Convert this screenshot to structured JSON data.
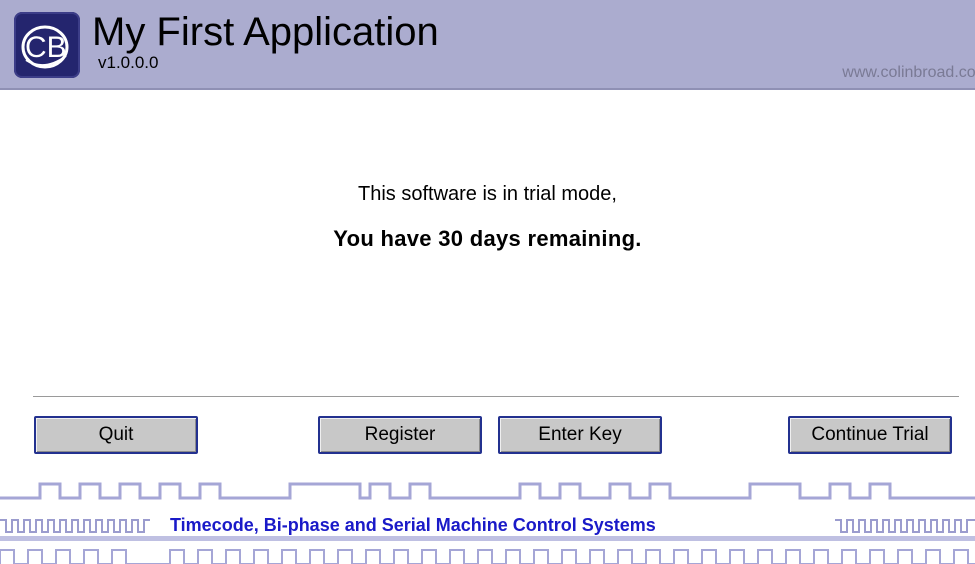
{
  "header": {
    "logo_text": "CB",
    "title": "My First Application",
    "version": "v1.0.0.0",
    "website": "www.colinbroad.com"
  },
  "message": {
    "line1": "This software is in trial mode,",
    "line2": "You have 30 days remaining."
  },
  "buttons": {
    "quit": "Quit",
    "register": "Register",
    "enter_key": "Enter Key",
    "continue_trial": "Continue Trial"
  },
  "footer": {
    "tagline": "Timecode, Bi-phase and Serial Machine Control Systems"
  },
  "colors": {
    "header_bg": "#abaccf",
    "logo_bg": "#24256e",
    "button_border": "#23318f",
    "tagline": "#1a1ac8",
    "waveform": "#a5a6d6"
  }
}
